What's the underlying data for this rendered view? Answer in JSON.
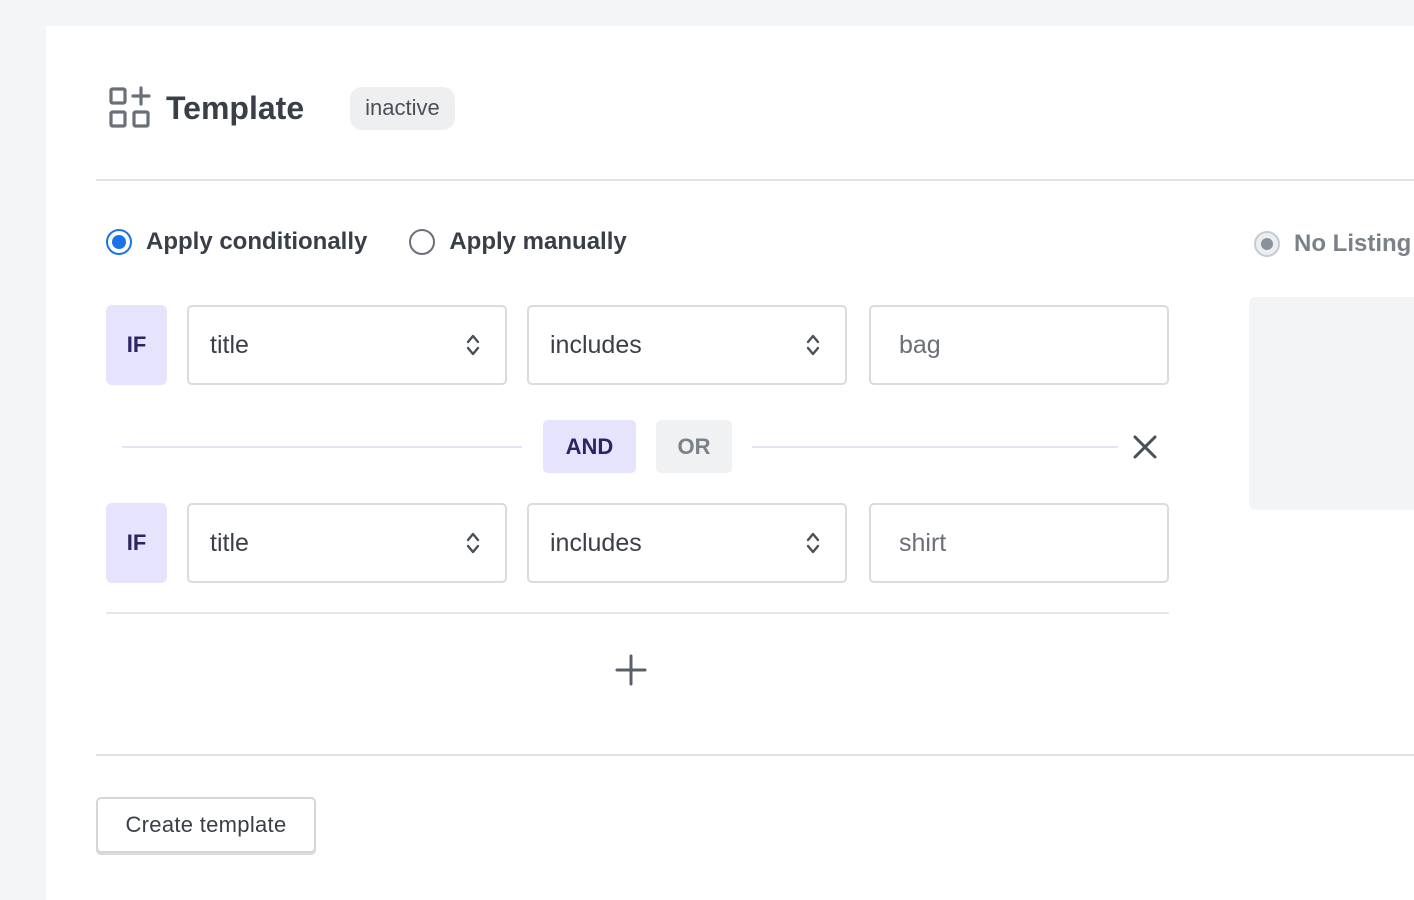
{
  "header": {
    "icon": "template-grid-add-icon",
    "title": "Template",
    "status": "inactive"
  },
  "apply_mode": {
    "options": [
      {
        "label": "Apply conditionally",
        "selected": true
      },
      {
        "label": "Apply manually",
        "selected": false
      }
    ]
  },
  "side": {
    "radio_label": "No Listing"
  },
  "rules": [
    {
      "prefix": "IF",
      "field": "title",
      "operator": "includes",
      "value": "bag"
    },
    {
      "prefix": "IF",
      "field": "title",
      "operator": "includes",
      "value": "shirt"
    }
  ],
  "connector": {
    "and_label": "AND",
    "or_label": "OR",
    "active": "AND"
  },
  "actions": {
    "create_label": "Create template"
  },
  "colors": {
    "accent": "#1a73e8",
    "if_badge_bg": "#e6e3fd",
    "if_badge_text": "#2b2466"
  }
}
